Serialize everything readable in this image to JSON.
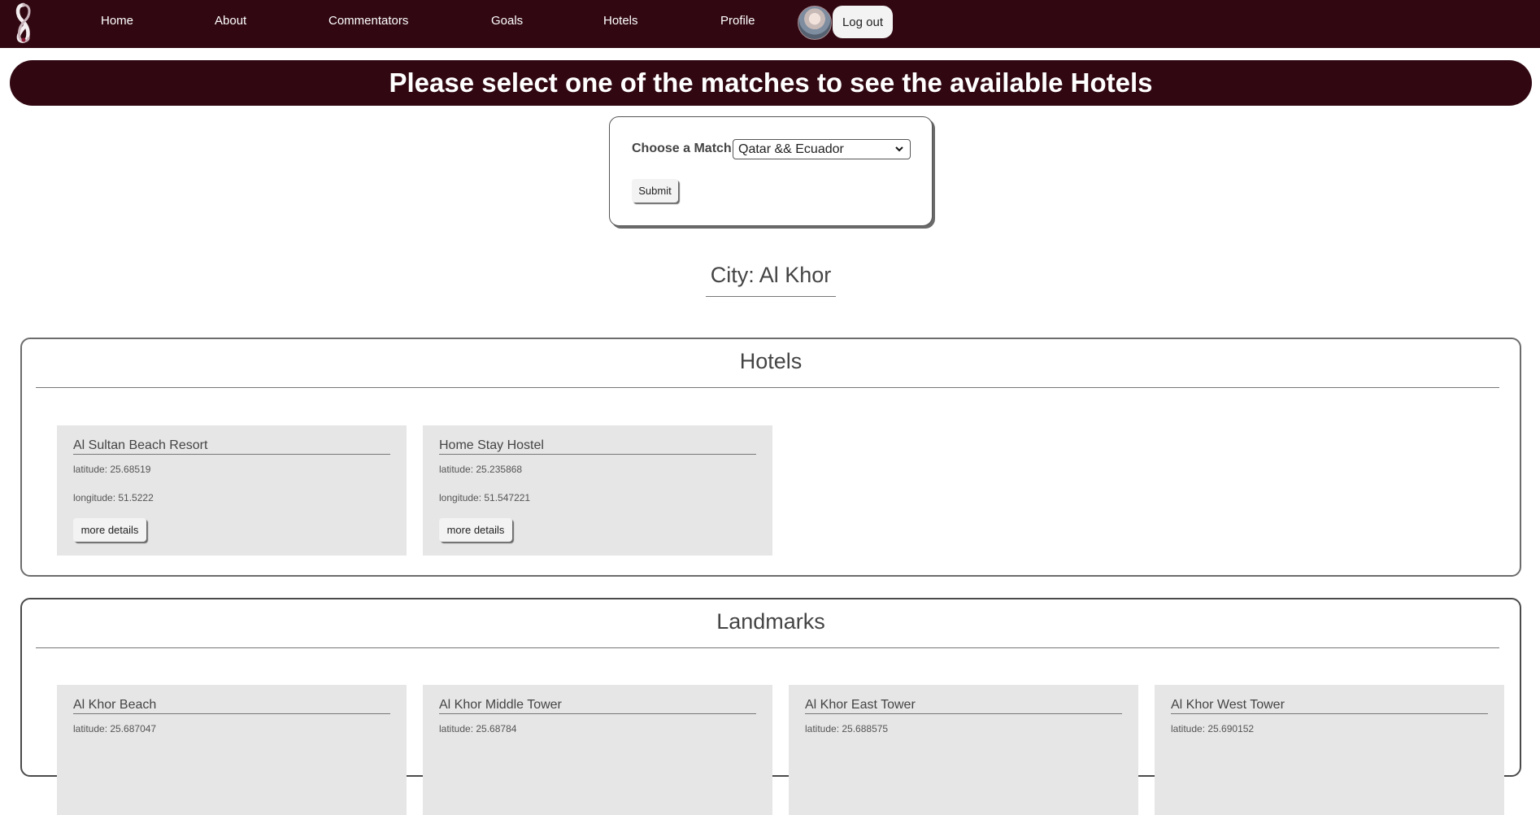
{
  "nav": {
    "items": [
      {
        "label": "Home"
      },
      {
        "label": "About"
      },
      {
        "label": "Commentators"
      },
      {
        "label": "Goals"
      },
      {
        "label": "Hotels"
      },
      {
        "label": "Profile"
      }
    ],
    "logout_label": "Log out"
  },
  "banner": {
    "text": "Please select one of the matches to see the available Hotels"
  },
  "form": {
    "label": "Choose a Match",
    "selected_match": "Qatar && Ecuador",
    "submit_label": "Submit"
  },
  "city": {
    "title": "City: Al Khor"
  },
  "hotels": {
    "title": "Hotels",
    "items": [
      {
        "name": "Al Sultan Beach Resort",
        "latitude": "latitude: 25.68519",
        "longitude": "longitude: 51.5222",
        "button": "more details"
      },
      {
        "name": "Home Stay Hostel",
        "latitude": "latitude: 25.235868",
        "longitude": "longitude: 51.547221",
        "button": "more details"
      }
    ]
  },
  "landmarks": {
    "title": "Landmarks",
    "items": [
      {
        "name": "Al Khor Beach",
        "latitude": "latitude: 25.687047"
      },
      {
        "name": "Al Khor Middle Tower",
        "latitude": "latitude: 25.68784"
      },
      {
        "name": "Al Khor East Tower",
        "latitude": "latitude: 25.688575"
      },
      {
        "name": "Al Khor West Tower",
        "latitude": "latitude: 25.690152"
      }
    ]
  },
  "colors": {
    "brand": "#310812",
    "card": "#e6e6e6"
  },
  "icons": {
    "logo": "world-cup-emblem-icon",
    "avatar": "user-avatar",
    "select_caret": "chevron-down-icon"
  }
}
